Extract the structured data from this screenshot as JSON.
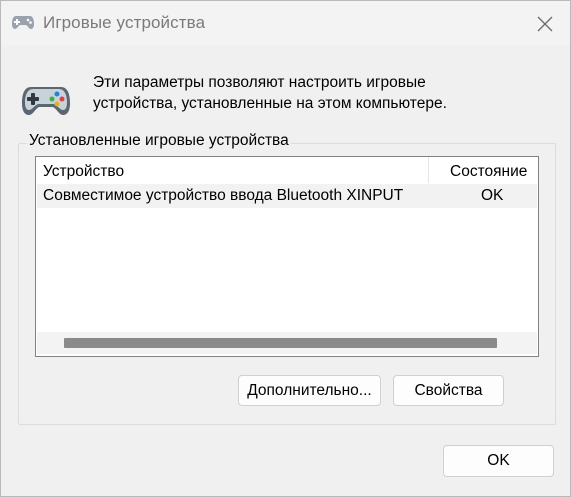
{
  "window": {
    "title": "Игровые устройства"
  },
  "intro": {
    "description": "Эти параметры позволяют настроить игровые устройства, установленные на этом компьютере."
  },
  "devices_group": {
    "label": "Установленные игровые устройства",
    "columns": {
      "device": "Устройство",
      "status": "Состояние"
    },
    "rows": [
      {
        "device": "Совместимое устройство ввода Bluetooth XINPUT",
        "status": "OK"
      }
    ],
    "buttons": {
      "advanced": "Дополнительно...",
      "properties": "Свойства"
    }
  },
  "footer": {
    "ok": "OK"
  },
  "icons": {
    "title": "gamepad-icon",
    "close": "close-icon",
    "header": "gamepad-icon"
  }
}
